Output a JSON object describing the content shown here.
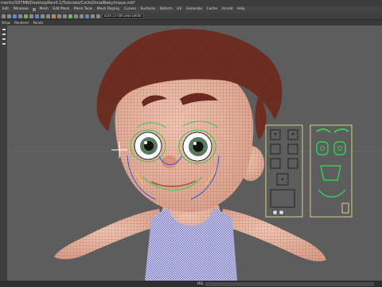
{
  "window": {
    "title": "ments/3DTMB/Desktop/Rev0.1/Tutorials/CoUnDimalBaby/maya.mb*"
  },
  "menu": {
    "items": [
      "Edit",
      "Windows",
      "Mesh",
      "Edit Mesh",
      "Mesh Tools",
      "Mesh Display",
      "Curves",
      "Surfaces",
      "Deform",
      "UV",
      "Generate",
      "Cache",
      "Arnold",
      "Help"
    ]
  },
  "toolbar": {
    "field_label": "ACES 1.0 SDR-video (sRGB)"
  },
  "panel_menu": {
    "items": [
      "Show",
      "Renderer",
      "Panels"
    ]
  },
  "statusbar": {
    "label": "MEL"
  },
  "icons": [
    "rig-face-control-panel-icon",
    "rig-picker-panel-icon",
    "grid-origin-icon"
  ]
}
